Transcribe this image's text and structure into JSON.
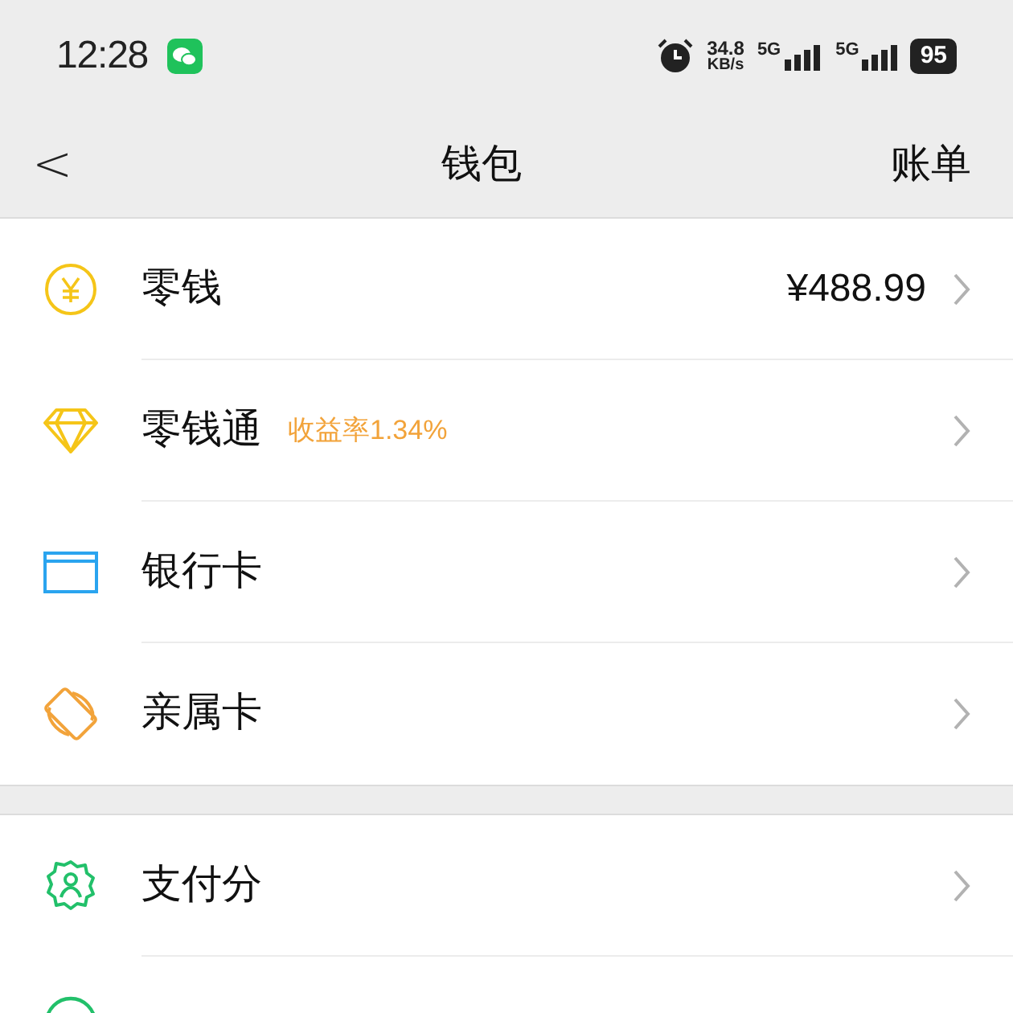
{
  "status_bar": {
    "time": "12:28",
    "speed": "34.8",
    "speed_unit": "KB/s",
    "networks": [
      "5G",
      "5G"
    ],
    "battery": "95"
  },
  "nav": {
    "back": "<",
    "title": "钱包",
    "action": "账单"
  },
  "sections": [
    {
      "items": [
        {
          "label": "零钱",
          "value": "¥488.99"
        },
        {
          "label": "零钱通",
          "tag": "收益率1.34%"
        },
        {
          "label": "银行卡"
        },
        {
          "label": "亲属卡"
        }
      ]
    },
    {
      "items": [
        {
          "label": "支付分"
        },
        {
          "kind": "partial"
        }
      ]
    }
  ]
}
